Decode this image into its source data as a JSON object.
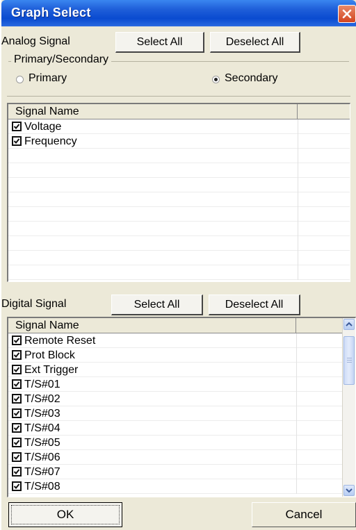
{
  "window": {
    "title": "Graph Select"
  },
  "analog": {
    "label": "Analog Signal",
    "select_all": "Select All",
    "deselect_all": "Deselect All",
    "group_title": "Primary/Secondary",
    "radio_primary": "Primary",
    "radio_secondary": "Secondary",
    "selected": "Secondary",
    "column_header": "Signal Name",
    "items": [
      {
        "label": "Voltage",
        "checked": true
      },
      {
        "label": "Frequency",
        "checked": true
      }
    ]
  },
  "digital": {
    "label": "Digital Signal",
    "select_all": "Select All",
    "deselect_all": "Deselect All",
    "column_header": "Signal Name",
    "items": [
      {
        "label": "Remote Reset",
        "checked": true
      },
      {
        "label": "Prot Block",
        "checked": true
      },
      {
        "label": "Ext Trigger",
        "checked": true
      },
      {
        "label": "T/S#01",
        "checked": true
      },
      {
        "label": "T/S#02",
        "checked": true
      },
      {
        "label": "T/S#03",
        "checked": true
      },
      {
        "label": "T/S#04",
        "checked": true
      },
      {
        "label": "T/S#05",
        "checked": true
      },
      {
        "label": "T/S#06",
        "checked": true
      },
      {
        "label": "T/S#07",
        "checked": true
      },
      {
        "label": "T/S#08",
        "checked": true
      }
    ]
  },
  "footer": {
    "ok_label": "OK",
    "cancel_label": "Cancel"
  },
  "icons": {
    "close": "close-icon",
    "check": "checkmark-icon",
    "scroll_up": "chevron-up-icon",
    "scroll_down": "chevron-down-icon"
  },
  "colors": {
    "titlebar": "#0a4bd0",
    "close": "#d3441f",
    "face": "#ece9d8"
  }
}
